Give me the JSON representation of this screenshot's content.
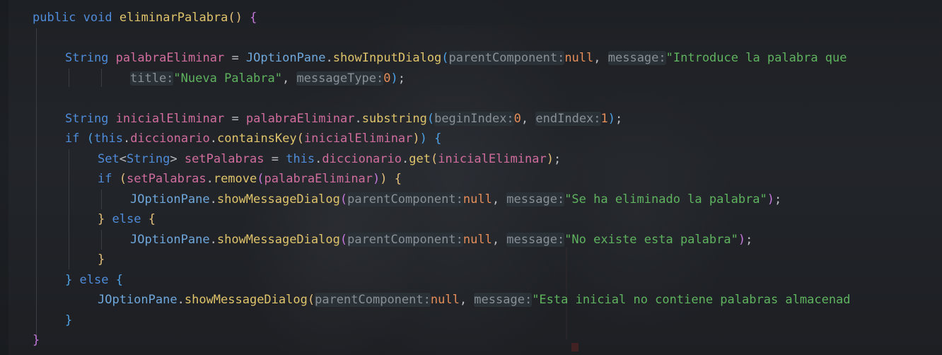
{
  "code": {
    "line1": {
      "kw_public": "public",
      "kw_void": "void",
      "method": "eliminarPalabra",
      "paren_open": "(",
      "paren_close": ")",
      "brace": "{"
    },
    "line2": {
      "type": "String",
      "var": "palabraEliminar",
      "eq": " = ",
      "cls": "JOptionPane",
      "dot": ".",
      "fn": "showInputDialog",
      "p_open": "(",
      "hint1": "parentComponent:",
      "null1": "null",
      "comma1": ", ",
      "hint2": "message:",
      "str": "\"Introduce la palabra que"
    },
    "line3": {
      "hint1": "title:",
      "str": "\"Nueva Palabra\"",
      "comma": ", ",
      "hint2": "messageType:",
      "num": "0",
      "p_close": ")",
      "semi": ";"
    },
    "line4": {
      "type": "String",
      "var": "inicialEliminar",
      "eq": " = ",
      "var2": "palabraEliminar",
      "dot": ".",
      "fn": "substring",
      "p_open": "(",
      "hint1": "beginIndex:",
      "num1": "0",
      "comma": ", ",
      "hint2": "endIndex:",
      "num2": "1",
      "p_close": ")",
      "semi": ";"
    },
    "line5": {
      "kw_if": "if",
      "p_open": "(",
      "kw_this": "this",
      "dot1": ".",
      "field": "diccionario",
      "dot2": ".",
      "fn": "containsKey",
      "p2_open": "(",
      "arg": "inicialEliminar",
      "p2_close": ")",
      "p_close": ")",
      "brace": "{"
    },
    "line6": {
      "type1": "Set",
      "lt": "<",
      "type2": "String",
      "gt": ">",
      "var": "setPalabras",
      "eq": " = ",
      "kw_this": "this",
      "dot1": ".",
      "field": "diccionario",
      "dot2": ".",
      "fn": "get",
      "p_open": "(",
      "arg": "inicialEliminar",
      "p_close": ")",
      "semi": ";"
    },
    "line7": {
      "kw_if": "if",
      "p_open": "(",
      "var": "setPalabras",
      "dot": ".",
      "fn": "remove",
      "p2_open": "(",
      "arg": "palabraEliminar",
      "p2_close": ")",
      "p_close": ")",
      "brace": "{"
    },
    "line8": {
      "cls": "JOptionPane",
      "dot": ".",
      "fn": "showMessageDialog",
      "p_open": "(",
      "hint1": "parentComponent:",
      "null1": "null",
      "comma": ", ",
      "hint2": "message:",
      "str": "\"Se ha eliminado la palabra\"",
      "p_close": ")",
      "semi": ";"
    },
    "line9": {
      "brace_close": "}",
      "kw_else": "else",
      "brace_open": "{"
    },
    "line10": {
      "cls": "JOptionPane",
      "dot": ".",
      "fn": "showMessageDialog",
      "p_open": "(",
      "hint1": "parentComponent:",
      "null1": "null",
      "comma": ", ",
      "hint2": "message:",
      "str": "\"No existe esta palabra\"",
      "p_close": ")",
      "semi": ";"
    },
    "line11": {
      "brace_close": "}"
    },
    "line12": {
      "brace_close": "}",
      "kw_else": "else",
      "brace_open": "{"
    },
    "line13": {
      "cls": "JOptionPane",
      "dot": ".",
      "fn": "showMessageDialog",
      "p_open": "(",
      "hint1": "parentComponent:",
      "null1": "null",
      "comma": ", ",
      "hint2": "message:",
      "str": "\"Esta inicial no contiene palabras almacenad"
    },
    "line14": {
      "brace_close": "}"
    },
    "line15": {
      "brace_close": "}"
    }
  },
  "colors": {
    "background": "#1f2126",
    "keyword": "#4f8cd9",
    "variable": "#d16d9e",
    "function": "#e0c46c",
    "string": "#5fb35f",
    "number": "#e58e5a",
    "hint": "#8a8f98"
  }
}
